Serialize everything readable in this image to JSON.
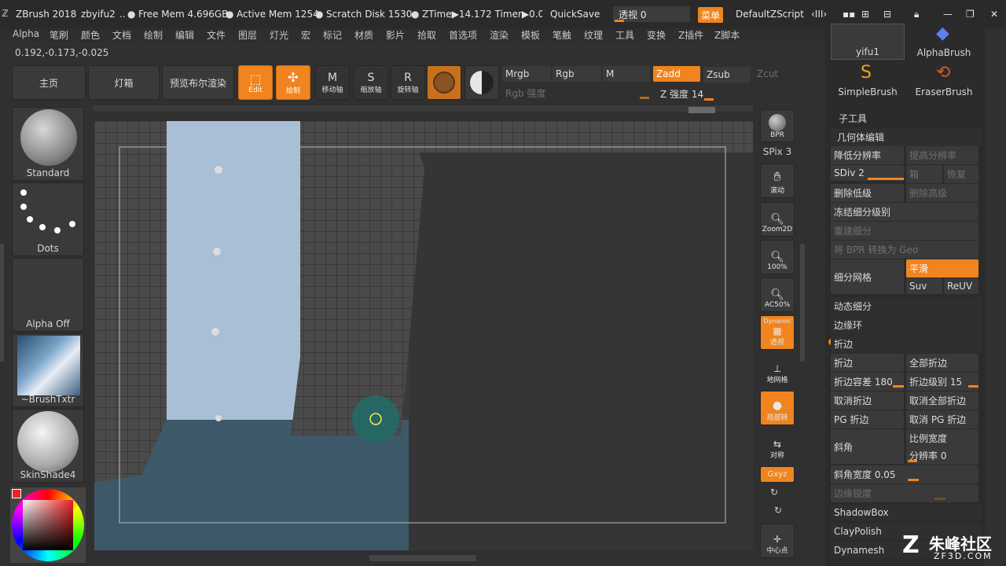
{
  "titlebar": {
    "app": "ZBrush 2018",
    "user": "zbyifu2",
    "free_mem": "Free Mem 4.696GB",
    "active_mem": "Active Mem 1254",
    "scratch": "Scratch Disk 1530",
    "ztime": "ZTime▶14.172 Timer▶0.0",
    "quicksave": "QuickSave",
    "perspective": "透视 0",
    "menu_btn": "菜单",
    "script": "DefaultZScript"
  },
  "menu": [
    "Alpha",
    "笔刷",
    "颜色",
    "文档",
    "绘制",
    "编辑",
    "文件",
    "图层",
    "灯光",
    "宏",
    "标记",
    "材质",
    "影片",
    "拾取",
    "首选项",
    "渲染",
    "模板",
    "笔触",
    "纹理",
    "工具",
    "变换",
    "Z插件",
    "Z脚本"
  ],
  "coords": "0.192,-0.173,-0.025",
  "shelf": {
    "home": "主页",
    "lightbox": "灯箱",
    "preview": "预览布尔渲染",
    "edit": "Edit",
    "draw": "绘制",
    "move": "移动轴",
    "scale": "缩放轴",
    "rotate": "旋转轴",
    "mrgb": "Mrgb",
    "rgb": "Rgb",
    "m": "M",
    "zadd": "Zadd",
    "zsub": "Zsub",
    "zcut": "Zcut",
    "rgb_intensity": "Rgb 强度",
    "z_intensity": "Z 强度 14"
  },
  "left": {
    "brush": "Standard",
    "stroke": "Dots",
    "alpha": "Alpha Off",
    "texture": "~BrushTxtr",
    "material": "SkinShade4"
  },
  "righttools": {
    "bpr": "BPR",
    "spix": "SPix 3",
    "scroll": "滚动",
    "zoom2d": "Zoom2D",
    "z100": "100%",
    "ac50": "AC50%",
    "dynamic": "Dynamic",
    "persp": "透视",
    "floor": "地网格",
    "local": "局部转",
    "sym": "对称",
    "xyz": "Gxyz",
    "center": "中心点"
  },
  "palette": {
    "tool1": "yifu1",
    "tool2": "AlphaBrush",
    "tool3": "SimpleBrush",
    "tool4": "EraserBrush",
    "subtool": "子工具",
    "geometry": "几何体编辑",
    "lower_res": "降低分辨率",
    "higher_res": "提高分辨率",
    "sdiv": "SDiv 2",
    "cage": "箱",
    "restore": "恢复",
    "del_lower": "删除低级",
    "del_higher": "删除高级",
    "freeze": "冻结细分级别",
    "reconstruct": "重建细分",
    "bpr_geo": "将 BPR 转换为 Geo",
    "divide": "细分网格",
    "smooth": "平滑",
    "suv": "Suv",
    "reuv": "ReUV",
    "dynamic_sub": "动态细分",
    "edgeloop": "边缘环",
    "crease_section": "折边",
    "crease": "折边",
    "crease_all": "全部折边",
    "crease_tol": "折边容差 180",
    "crease_lvl": "折边级别 15",
    "uncrease": "取消折边",
    "uncrease_all": "取消全部折边",
    "pg_crease": "PG 折边",
    "pg_uncrease": "取消 PG 折边",
    "bevel": "斜角",
    "ratio_width": "比例宽度",
    "resolution": "分辨率 0",
    "bevel_width": "斜角宽度 0.05",
    "edge_sharp": "边缘锐度",
    "shadowbox": "ShadowBox",
    "claypolish": "ClayPolish",
    "dynamesh": "Dynamesh"
  },
  "watermark": {
    "brand": "朱峰社区",
    "url": "ZF3D.COM"
  }
}
